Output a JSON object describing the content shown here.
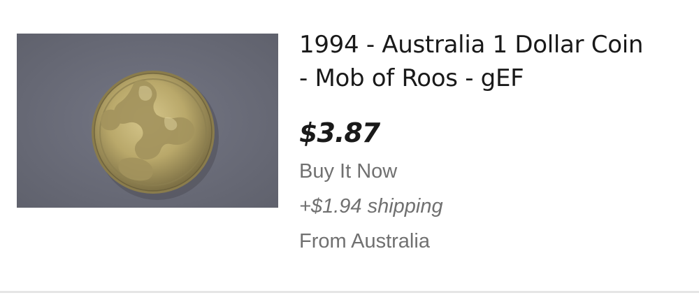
{
  "listing": {
    "image_alt": "1994 Australia 1 Dollar Coin - Mob of Roos",
    "title_line1": "1994 - Australia 1 Dollar Coin",
    "title_line2": "- Mob of Roos - gEF",
    "price": "$3.87",
    "format": "Buy It Now",
    "shipping": "+$1.94 shipping",
    "location": "From Australia"
  },
  "colors": {
    "text_primary": "#191919",
    "text_secondary": "#707070",
    "divider": "#e5e5e5",
    "image_background": "#6c6e7a",
    "coin_gold": "#b9a86a"
  }
}
